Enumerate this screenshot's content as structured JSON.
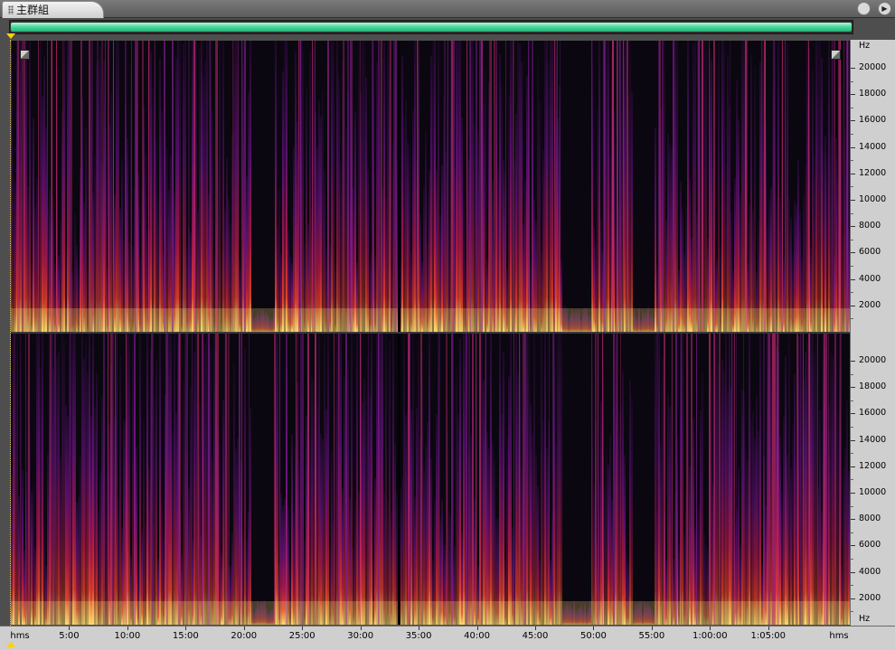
{
  "window": {
    "tab_title": "主群組",
    "buttons": [
      {
        "icon": "circle-menu-icon",
        "glyph": ""
      },
      {
        "icon": "play-icon",
        "glyph": "▶"
      }
    ]
  },
  "overview": {
    "visible_fraction": 1.0,
    "color": "#43d79b"
  },
  "channels": [
    {
      "name": "channel-1"
    },
    {
      "name": "channel-2"
    }
  ],
  "frequency_ruler": {
    "unit": "Hz",
    "labels": [
      "20000",
      "18000",
      "16000",
      "14000",
      "12000",
      "10000",
      "8000",
      "6000",
      "4000",
      "2000"
    ],
    "values": [
      20000,
      18000,
      16000,
      14000,
      12000,
      10000,
      8000,
      6000,
      4000,
      2000
    ],
    "max": 22050
  },
  "time_ruler": {
    "unit_label": "hms",
    "labels": [
      "5:00",
      "10:00",
      "15:00",
      "20:00",
      "25:00",
      "30:00",
      "35:00",
      "40:00",
      "45:00",
      "50:00",
      "55:00",
      "1:00:00",
      "1:05:00"
    ],
    "values_min": [
      5,
      10,
      15,
      20,
      25,
      30,
      35,
      40,
      45,
      50,
      55,
      60,
      65
    ],
    "total_min": 72,
    "end_label": "hms"
  },
  "colors": {
    "spectrogram_low": "#0b0710",
    "spectrogram_mid": "#5a1070",
    "spectrogram_high": "#e0402a",
    "spectrogram_peak": "#ffe070",
    "playhead_marker": "#ffd100"
  },
  "spectrogram": {
    "silent_segments_min": [
      [
        20.5,
        22.5
      ],
      [
        47.3,
        49.8
      ],
      [
        53.3,
        55.2
      ]
    ],
    "dark_lines_min": [
      33.2
    ]
  }
}
